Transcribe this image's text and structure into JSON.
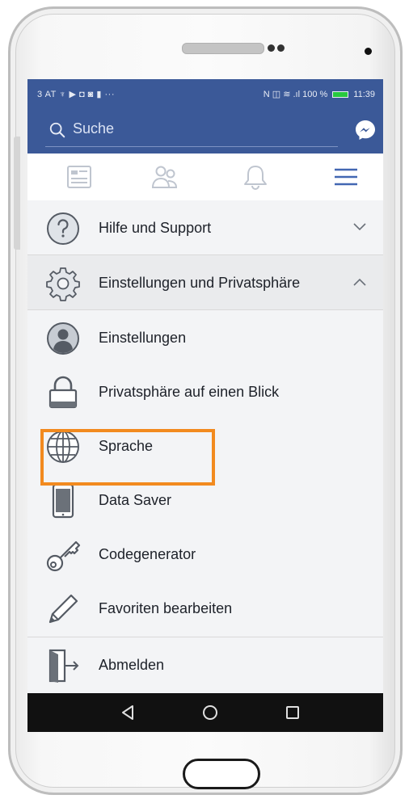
{
  "status": {
    "left": "3 AT ♆ ▶ ◘ ◙ ▮ ···",
    "right": "N ◫ ≋ .ıl 100 %",
    "time": "11:39"
  },
  "search": {
    "placeholder": "Suche"
  },
  "tabs": [
    "news-feed",
    "friends",
    "notifications",
    "menu"
  ],
  "menu": {
    "items": [
      {
        "label": "Hilfe und Support",
        "icon": "help-icon",
        "chevron": "down"
      },
      {
        "label": "Einstellungen und Privatsphäre",
        "icon": "gear-icon",
        "chevron": "up"
      },
      {
        "label": "Einstellungen",
        "icon": "user-settings-icon"
      },
      {
        "label": "Privatsphäre auf einen Blick",
        "icon": "lock-icon"
      },
      {
        "label": "Sprache",
        "icon": "globe-icon"
      },
      {
        "label": "Data Saver",
        "icon": "phone-icon"
      },
      {
        "label": "Codegenerator",
        "icon": "key-icon"
      },
      {
        "label": "Favoriten bearbeiten",
        "icon": "pencil-icon"
      },
      {
        "label": "Abmelden",
        "icon": "logout-icon"
      }
    ]
  },
  "colors": {
    "brand": "#3b5998",
    "highlight": "#f28a1f",
    "menu_bg": "#f3f4f6"
  }
}
